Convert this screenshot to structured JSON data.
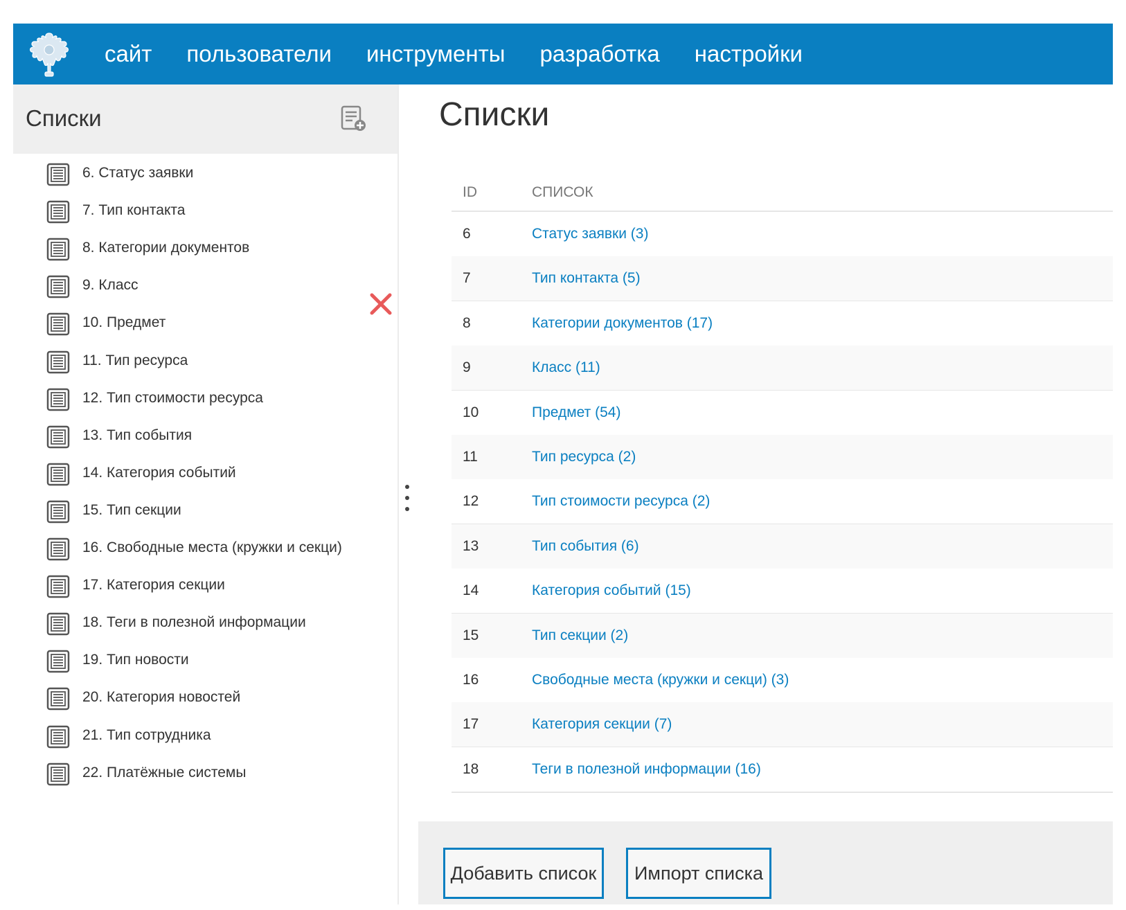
{
  "nav": {
    "items": [
      {
        "id": "site",
        "label": "сайт"
      },
      {
        "id": "users",
        "label": "пользователи"
      },
      {
        "id": "tools",
        "label": "инструменты"
      },
      {
        "id": "dev",
        "label": "разработка"
      },
      {
        "id": "settings",
        "label": "настройки"
      }
    ],
    "logo_icon": "eagle-emblem-icon"
  },
  "sidebar": {
    "title": "Списки",
    "add_icon": "add-list-icon",
    "items": [
      {
        "label": "6. Статус заявки"
      },
      {
        "label": "7. Тип контакта"
      },
      {
        "label": "8. Категории документов"
      },
      {
        "label": "9. Класс"
      },
      {
        "label": "10. Предмет"
      },
      {
        "label": "11. Тип ресурса"
      },
      {
        "label": "12. Тип стоимости ресурса"
      },
      {
        "label": "13. Тип события"
      },
      {
        "label": "14. Категория событий"
      },
      {
        "label": "15. Тип секции"
      },
      {
        "label": "16. Свободные места (кружки и секци)"
      },
      {
        "label": "17. Категория секции"
      },
      {
        "label": "18. Теги в полезной информации"
      },
      {
        "label": "19. Тип новости"
      },
      {
        "label": "20. Категория новостей"
      },
      {
        "label": "21. Тип сотрудника"
      },
      {
        "label": "22. Платёжные системы"
      }
    ]
  },
  "main": {
    "title": "Списки",
    "table": {
      "columns": [
        "ID",
        "СПИСОК"
      ],
      "rows": [
        {
          "id": "6",
          "name": "Статус заявки (3)"
        },
        {
          "id": "7",
          "name": "Тип контакта (5)"
        },
        {
          "id": "8",
          "name": "Категории документов (17)"
        },
        {
          "id": "9",
          "name": "Класс (11)"
        },
        {
          "id": "10",
          "name": "Предмет (54)"
        },
        {
          "id": "11",
          "name": "Тип ресурса (2)"
        },
        {
          "id": "12",
          "name": "Тип стоимости ресурса (2)"
        },
        {
          "id": "13",
          "name": "Тип события (6)"
        },
        {
          "id": "14",
          "name": "Категория событий (15)"
        },
        {
          "id": "15",
          "name": "Тип секции (2)"
        },
        {
          "id": "16",
          "name": "Свободные места (кружки и секци) (3)"
        },
        {
          "id": "17",
          "name": "Категория секции (7)"
        },
        {
          "id": "18",
          "name": "Теги в полезной информации (16)"
        }
      ]
    },
    "buttons": {
      "add": "Добавить список",
      "import": "Импорт списка"
    }
  },
  "colors": {
    "accent": "#0a7fc1",
    "delete": "#e85a5a"
  }
}
